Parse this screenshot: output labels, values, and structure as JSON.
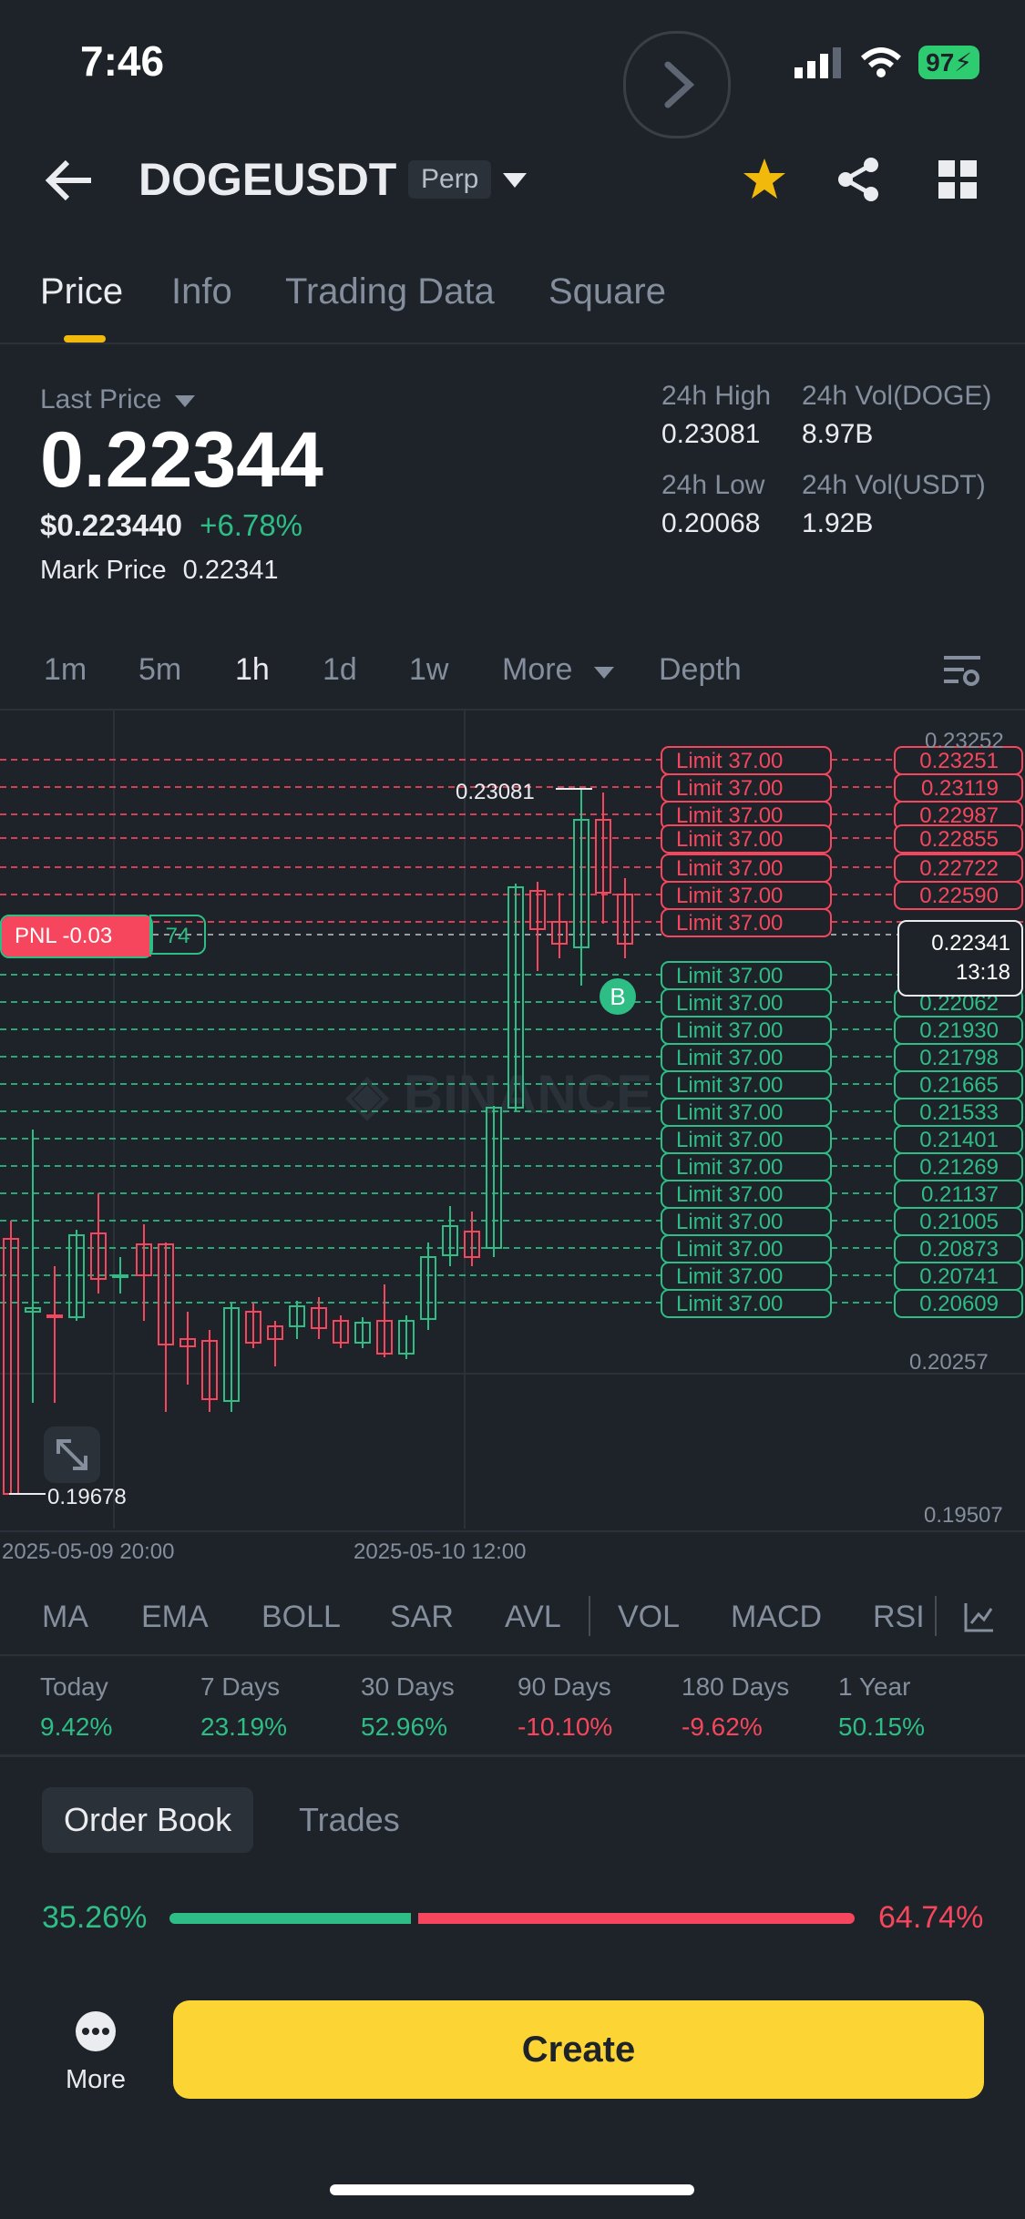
{
  "status": {
    "time": "7:46",
    "battery": "97"
  },
  "header": {
    "symbol": "DOGEUSDT",
    "type": "Perp"
  },
  "tabs": [
    {
      "label": "Price"
    },
    {
      "label": "Info"
    },
    {
      "label": "Trading Data"
    },
    {
      "label": "Square"
    }
  ],
  "price": {
    "last_price_label": "Last Price",
    "last_price": "0.22344",
    "usd_price": "$0.223440",
    "change": "+6.78%",
    "mark_label": "Mark Price",
    "mark_value": "0.22341",
    "high_label": "24h High",
    "high_value": "0.23081",
    "low_label": "24h Low",
    "low_value": "0.20068",
    "vol_doge_label": "24h Vol(DOGE)",
    "vol_doge_value": "8.97B",
    "vol_usdt_label": "24h Vol(USDT)",
    "vol_usdt_value": "1.92B"
  },
  "intervals": [
    {
      "label": "1m"
    },
    {
      "label": "5m"
    },
    {
      "label": "1h"
    },
    {
      "label": "1d"
    },
    {
      "label": "1w"
    },
    {
      "label": "More"
    },
    {
      "label": "Depth"
    }
  ],
  "chart": {
    "pnl_label": "PNL -0.03",
    "pnl_qty": "74",
    "current_price": "0.22341",
    "countdown": "13:18",
    "high_marker": "0.23081",
    "low_marker": "0.19678",
    "buy_marker": "B",
    "axis_labels": [
      "0.23252",
      "0.20257",
      "0.19507"
    ],
    "dates": [
      "2025-05-09 20:00",
      "2025-05-10 12:00"
    ],
    "sell_orders": [
      {
        "label": "Limit  37.00",
        "price": "0.23251"
      },
      {
        "label": "Limit  37.00",
        "price": "0.23119"
      },
      {
        "label": "Limit  37.00",
        "price": "0.22987"
      },
      {
        "label": "Limit  37.00",
        "price": "0.22855"
      },
      {
        "label": "Limit  37.00",
        "price": "0.22722"
      },
      {
        "label": "Limit  37.00",
        "price": "0.22590"
      },
      {
        "label": "Limit  37.00",
        "price": ""
      }
    ],
    "buy_orders": [
      {
        "label": "Limit  37.00",
        "price": ""
      },
      {
        "label": "Limit  37.00",
        "price": "0.22062"
      },
      {
        "label": "Limit  37.00",
        "price": "0.21930"
      },
      {
        "label": "Limit  37.00",
        "price": "0.21798"
      },
      {
        "label": "Limit  37.00",
        "price": "0.21665"
      },
      {
        "label": "Limit  37.00",
        "price": "0.21533"
      },
      {
        "label": "Limit  37.00",
        "price": "0.21401"
      },
      {
        "label": "Limit  37.00",
        "price": "0.21269"
      },
      {
        "label": "Limit  37.00",
        "price": "0.21137"
      },
      {
        "label": "Limit  37.00",
        "price": "0.21005"
      },
      {
        "label": "Limit  37.00",
        "price": "0.20873"
      },
      {
        "label": "Limit  37.00",
        "price": "0.20741"
      },
      {
        "label": "Limit  37.00",
        "price": "0.20609"
      }
    ]
  },
  "indicators": [
    {
      "label": "MA"
    },
    {
      "label": "EMA"
    },
    {
      "label": "BOLL"
    },
    {
      "label": "SAR"
    },
    {
      "label": "AVL"
    },
    {
      "label": "VOL"
    },
    {
      "label": "MACD"
    },
    {
      "label": "RSI"
    }
  ],
  "performance": [
    {
      "label": "Today",
      "value": "9.42%",
      "color": "#2ebd85"
    },
    {
      "label": "7 Days",
      "value": "23.19%",
      "color": "#2ebd85"
    },
    {
      "label": "30 Days",
      "value": "52.96%",
      "color": "#2ebd85"
    },
    {
      "label": "90 Days",
      "value": "-10.10%",
      "color": "#f6465d"
    },
    {
      "label": "180 Days",
      "value": "-9.62%",
      "color": "#f6465d"
    },
    {
      "label": "1 Year",
      "value": "50.15%",
      "color": "#2ebd85"
    }
  ],
  "orderbook": {
    "tab_book": "Order Book",
    "tab_trades": "Trades",
    "buy_ratio": "35.26%",
    "sell_ratio": "64.74%",
    "buy_fraction": 0.3526
  },
  "bottom": {
    "more": "More",
    "create": "Create"
  },
  "colors": {
    "up": "#2ebd85",
    "down": "#f6465d",
    "accent": "#fcd535"
  }
}
